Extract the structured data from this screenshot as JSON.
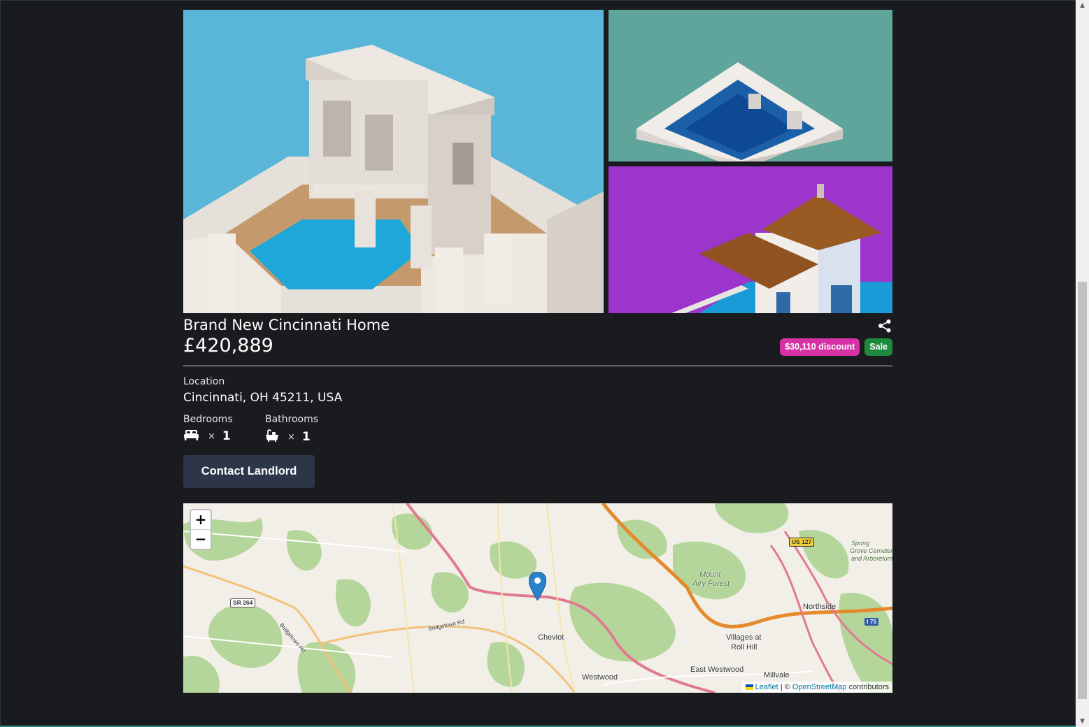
{
  "listing": {
    "title": "Brand New Cincinnati Home",
    "price": "£420,889",
    "discount_badge": "$30,110 discount",
    "sale_badge": "Sale",
    "location_label": "Location",
    "location_value": "Cincinnati, OH 45211, USA",
    "bedrooms_label": "Bedrooms",
    "bedrooms_times": "×",
    "bedrooms_count": "1",
    "bathrooms_label": "Bathrooms",
    "bathrooms_times": "×",
    "bathrooms_count": "1",
    "contact_button": "Contact Landlord"
  },
  "icons": {
    "share": "share-icon",
    "bed": "bed-icon",
    "bath": "bath-icon",
    "marker": "map-marker-icon"
  },
  "colors": {
    "discount_badge": "#d632a5",
    "sale_badge": "#1e8a3d",
    "contact_button": "#2c3648",
    "background": "#1a1b1f"
  },
  "map": {
    "zoom_in": "+",
    "zoom_out": "−",
    "attribution_leaflet": "Leaflet",
    "attribution_sep": " | © ",
    "attribution_osm": "OpenStreetMap",
    "attribution_tail": " contributors",
    "labels": {
      "cheviot": "Cheviot",
      "westwood": "Westwood",
      "east_westwood": "East Westwood",
      "villages": "Villages at",
      "roll_hill": "Roll Hill",
      "northside": "Northside",
      "millvale": "Millvale",
      "mount": "Mount",
      "airy": "Airy Forest",
      "spring": "Spring",
      "grove": "Grove Cemetery",
      "arboretum": "and Arboretum",
      "bridgetown": "Bridgetown Rd",
      "bridgetown2": "Bridgetown Rd",
      "sr264": "SR 264",
      "us127": "US 127",
      "i75": "I 75"
    }
  }
}
